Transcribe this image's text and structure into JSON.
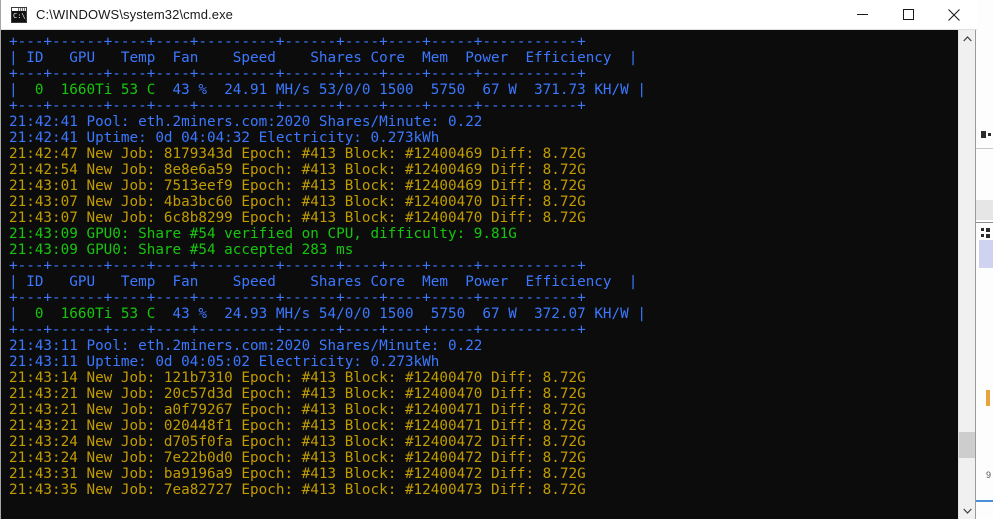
{
  "window": {
    "title": "C:\\WINDOWS\\system32\\cmd.exe",
    "icon": "cmd-icon",
    "icon_text": "C:\\_",
    "minimize_label": "Minimize",
    "maximize_label": "Maximize",
    "close_label": "Close"
  },
  "colors": {
    "background": "#0c0c0c",
    "blue": "#3b78ff",
    "green": "#16c60c",
    "yellow": "#c19c00",
    "titlebar": "#ffffff",
    "scrollbar_track": "#f0f0f0",
    "scrollbar_thumb": "#cdcdcd"
  },
  "scrollbar": {
    "up_arrow": "scroll-up-arrow",
    "down_arrow": "scroll-down-arrow",
    "thumb": "scroll-thumb"
  },
  "console": {
    "table_headers": [
      "ID",
      "GPU",
      "Temp",
      "Fan",
      "Speed",
      "Shares",
      "Core",
      "Mem",
      "Power",
      "Efficiency"
    ],
    "lines": [
      {
        "text": "+---+------+----+----+---------+------+----+----+-----+----------+",
        "color": "blue"
      },
      {
        "text": "| ID  GPU   Temp Fan    Speed   Shares Core  Mem  Power  Efficiency |",
        "color": "blue"
      },
      {
        "text": "+---+------+----+----+---------+------+----+----+-----+----------+",
        "color": "blue"
      },
      {
        "text": "|  0  1660Ti 53 C  43 %  24.91 MH/s 53/0/0 1500  5750   67 W  371.73 KH/W |",
        "color": "mixed-row",
        "segments": [
          {
            "text": "| ",
            "color": "blue"
          },
          {
            "text": " 0  1660Ti 53 C",
            "color": "green"
          },
          {
            "text": "  43 %  24.91 MH/s 53/0/0 1500  5750  67 W  371.73 KH/W ",
            "color": "blue"
          },
          {
            "text": "|",
            "color": "blue"
          }
        ]
      },
      {
        "text": "+---+------+----+----+---------+------+----+----+-----+----------+",
        "color": "blue"
      },
      {
        "text": "21:42:41 Pool: eth.2miners.com:2020 Shares/Minute: 0.22",
        "color": "blue"
      },
      {
        "text": "21:42:41 Uptime: 0d 04:04:32 Electricity: 0.273kWh",
        "color": "blue"
      },
      {
        "text": "21:42:47 New Job: 8179343d Epoch: #413 Block: #12400469 Diff: 8.72G",
        "color": "yellow"
      },
      {
        "text": "21:42:54 New Job: 8e8e6a59 Epoch: #413 Block: #12400469 Diff: 8.72G",
        "color": "yellow"
      },
      {
        "text": "21:43:01 New Job: 7513eef9 Epoch: #413 Block: #12400469 Diff: 8.72G",
        "color": "yellow"
      },
      {
        "text": "21:43:07 New Job: 4ba3bc60 Epoch: #413 Block: #12400470 Diff: 8.72G",
        "color": "yellow"
      },
      {
        "text": "21:43:07 New Job: 6c8b8299 Epoch: #413 Block: #12400470 Diff: 8.72G",
        "color": "yellow"
      },
      {
        "text": "21:43:09 GPU0: Share #54 verified on CPU, difficulty: 9.81G",
        "color": "green"
      },
      {
        "text": "21:43:09 GPU0: Share #54 accepted 283 ms",
        "color": "green"
      },
      {
        "text": "+---+------+----+----+---------+------+----+----+-----+----------+",
        "color": "blue"
      },
      {
        "text": "| ID  GPU   Temp Fan    Speed   Shares Core  Mem  Power  Efficiency |",
        "color": "blue"
      },
      {
        "text": "+---+------+----+----+---------+------+----+----+-----+----------+",
        "color": "blue"
      },
      {
        "text": "|  0  1660Ti 53 C  43 %  24.93 MH/s 54/0/0 1500  5750   67 W  372.07 KH/W |",
        "color": "mixed-row"
      },
      {
        "text": "+---+------+----+----+---------+------+----+----+-----+----------+",
        "color": "blue"
      },
      {
        "text": "21:43:11 Pool: eth.2miners.com:2020 Shares/Minute: 0.22",
        "color": "blue"
      },
      {
        "text": "21:43:11 Uptime: 0d 04:05:02 Electricity: 0.273kWh",
        "color": "blue"
      },
      {
        "text": "21:43:14 New Job: 121b7310 Epoch: #413 Block: #12400470 Diff: 8.72G",
        "color": "yellow"
      },
      {
        "text": "21:43:21 New Job: 20c57d3d Epoch: #413 Block: #12400470 Diff: 8.72G",
        "color": "yellow"
      },
      {
        "text": "21:43:21 New Job: a0f79267 Epoch: #413 Block: #12400471 Diff: 8.72G",
        "color": "yellow"
      },
      {
        "text": "21:43:21 New Job: 020448f1 Epoch: #413 Block: #12400471 Diff: 8.72G",
        "color": "yellow"
      },
      {
        "text": "21:43:24 New Job: d705f0fa Epoch: #413 Block: #12400472 Diff: 8.72G",
        "color": "yellow"
      },
      {
        "text": "21:43:24 New Job: 7e22b0d0 Epoch: #413 Block: #12400472 Diff: 8.72G",
        "color": "yellow"
      },
      {
        "text": "21:43:31 New Job: ba9196a9 Epoch: #413 Block: #12400472 Diff: 8.72G",
        "color": "yellow"
      },
      {
        "text": "21:43:35 New Job: 7ea82727 Epoch: #413 Block: #12400473 Diff: 8.72G",
        "color": "yellow"
      }
    ],
    "rendered": [
      {
        "type": "rule",
        "color": "blue",
        "text": "+---+------+----+----+---------+------+----+----+-----+-----------+"
      },
      {
        "type": "header",
        "color": "blue",
        "text": "| ID   GPU   Temp  Fan    Speed    Shares Core  Mem  Power  Efficiency  |"
      },
      {
        "type": "rule",
        "color": "blue",
        "text": "+---+------+----+----+---------+------+----+----+-----+-----------+"
      },
      {
        "type": "gpurow",
        "parts": [
          {
            "text": "|  ",
            "color": "blue"
          },
          {
            "text": "0  1660Ti 53 C",
            "color": "green"
          },
          {
            "text": "  43 %  24.91 MH/s 53/0/0 1500  5750  67 W  371.73 KH/W |",
            "color": "blue"
          }
        ]
      },
      {
        "type": "rule",
        "color": "blue",
        "text": "+---+------+----+----+---------+------+----+----+-----+-----------+"
      },
      {
        "type": "log",
        "color": "blue",
        "text": "21:42:41 Pool: eth.2miners.com:2020 Shares/Minute: 0.22"
      },
      {
        "type": "log",
        "color": "blue",
        "text": "21:42:41 Uptime: 0d 04:04:32 Electricity: 0.273kWh"
      },
      {
        "type": "log",
        "color": "yellow",
        "text": "21:42:47 New Job: 8179343d Epoch: #413 Block: #12400469 Diff: 8.72G"
      },
      {
        "type": "log",
        "color": "yellow",
        "text": "21:42:54 New Job: 8e8e6a59 Epoch: #413 Block: #12400469 Diff: 8.72G"
      },
      {
        "type": "log",
        "color": "yellow",
        "text": "21:43:01 New Job: 7513eef9 Epoch: #413 Block: #12400469 Diff: 8.72G"
      },
      {
        "type": "log",
        "color": "yellow",
        "text": "21:43:07 New Job: 4ba3bc60 Epoch: #413 Block: #12400470 Diff: 8.72G"
      },
      {
        "type": "log",
        "color": "yellow",
        "text": "21:43:07 New Job: 6c8b8299 Epoch: #413 Block: #12400470 Diff: 8.72G"
      },
      {
        "type": "log",
        "color": "green",
        "text": "21:43:09 GPU0: Share #54 verified on CPU, difficulty: 9.81G"
      },
      {
        "type": "log",
        "color": "green",
        "text": "21:43:09 GPU0: Share #54 accepted 283 ms"
      },
      {
        "type": "rule",
        "color": "blue",
        "text": "+---+------+----+----+---------+------+----+----+-----+-----------+"
      },
      {
        "type": "header",
        "color": "blue",
        "text": "| ID   GPU   Temp  Fan    Speed    Shares Core  Mem  Power  Efficiency  |"
      },
      {
        "type": "rule",
        "color": "blue",
        "text": "+---+------+----+----+---------+------+----+----+-----+-----------+"
      },
      {
        "type": "gpurow",
        "parts": [
          {
            "text": "|  ",
            "color": "blue"
          },
          {
            "text": "0  1660Ti 53 C",
            "color": "green"
          },
          {
            "text": "  43 %  24.93 MH/s 54/0/0 1500  5750  67 W  372.07 KH/W |",
            "color": "blue"
          }
        ]
      },
      {
        "type": "rule",
        "color": "blue",
        "text": "+---+------+----+----+---------+------+----+----+-----+-----------+"
      },
      {
        "type": "log",
        "color": "blue",
        "text": "21:43:11 Pool: eth.2miners.com:2020 Shares/Minute: 0.22"
      },
      {
        "type": "log",
        "color": "blue",
        "text": "21:43:11 Uptime: 0d 04:05:02 Electricity: 0.273kWh"
      },
      {
        "type": "log",
        "color": "yellow",
        "text": "21:43:14 New Job: 121b7310 Epoch: #413 Block: #12400470 Diff: 8.72G"
      },
      {
        "type": "log",
        "color": "yellow",
        "text": "21:43:21 New Job: 20c57d3d Epoch: #413 Block: #12400470 Diff: 8.72G"
      },
      {
        "type": "log",
        "color": "yellow",
        "text": "21:43:21 New Job: a0f79267 Epoch: #413 Block: #12400471 Diff: 8.72G"
      },
      {
        "type": "log",
        "color": "yellow",
        "text": "21:43:21 New Job: 020448f1 Epoch: #413 Block: #12400471 Diff: 8.72G"
      },
      {
        "type": "log",
        "color": "yellow",
        "text": "21:43:24 New Job: d705f0fa Epoch: #413 Block: #12400472 Diff: 8.72G"
      },
      {
        "type": "log",
        "color": "yellow",
        "text": "21:43:24 New Job: 7e22b0d0 Epoch: #413 Block: #12400472 Diff: 8.72G"
      },
      {
        "type": "log",
        "color": "yellow",
        "text": "21:43:31 New Job: ba9196a9 Epoch: #413 Block: #12400472 Diff: 8.72G"
      },
      {
        "type": "log",
        "color": "yellow",
        "text": "21:43:35 New Job: 7ea82727 Epoch: #413 Block: #12400473 Diff: 8.72G"
      }
    ],
    "gpu_table_1": {
      "id": "0",
      "gpu": "1660Ti",
      "temp": "53 C",
      "fan": "43 %",
      "speed": "24.91 MH/s",
      "shares": "53/0/0",
      "core": "1500",
      "mem": "5750",
      "power": "67 W",
      "efficiency": "371.73 KH/W"
    },
    "gpu_table_2": {
      "id": "0",
      "gpu": "1660Ti",
      "temp": "53 C",
      "fan": "43 %",
      "speed": "24.93 MH/s",
      "shares": "54/0/0",
      "core": "1500",
      "mem": "5750",
      "power": "67 W",
      "efficiency": "372.07 KH/W"
    }
  }
}
